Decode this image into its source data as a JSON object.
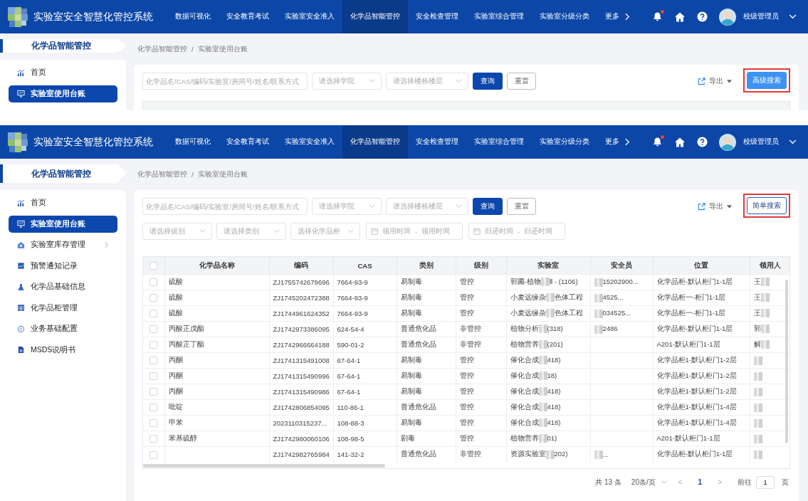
{
  "screens": [
    {
      "kind": "cropped",
      "app_title": "实验室安全智慧化管控系统",
      "nav": [
        {
          "label": "数据可视化",
          "selected": false
        },
        {
          "label": "安全教育考试",
          "selected": false
        },
        {
          "label": "实验室安全准入",
          "selected": false
        },
        {
          "label": "化学品智能管控",
          "selected": true
        },
        {
          "label": "安全检查管理",
          "selected": false
        },
        {
          "label": "实验室综合管理",
          "selected": false
        },
        {
          "label": "实验室分级分类",
          "selected": false
        }
      ],
      "more": {
        "label": "更多"
      },
      "notifications": {
        "unread": true
      },
      "user": {
        "name": "校级管理员"
      },
      "sidebar": {
        "title": "化学品智能管控",
        "items": [
          {
            "label": "首页",
            "selected": false,
            "submenu": false
          },
          {
            "label": "实验室使用台账",
            "selected": true,
            "submenu": false
          }
        ]
      },
      "breadcrumb": {
        "items": [
          "化学品智能管控",
          "实验室使用台账"
        ],
        "separator": "/"
      },
      "filters": [
        [
          {
            "kind": "input",
            "placeholder": "化学品名/CAS/编码/实验室/房间号/姓名/联系方式"
          },
          {
            "kind": "select",
            "placeholder": "请选择学院"
          },
          {
            "kind": "select",
            "placeholder": "请选择楼栋楼层"
          },
          {
            "kind": "primary",
            "label": "查询"
          },
          {
            "kind": "plain",
            "label": "重置"
          }
        ]
      ],
      "export": {
        "label": "导出"
      },
      "toggle": {
        "label": "高级搜索",
        "kind": "filled",
        "highlighted": true
      }
    },
    {
      "kind": "full",
      "app_title": "实验室安全智慧化管控系统",
      "nav": [
        {
          "label": "数据可视化",
          "selected": false
        },
        {
          "label": "安全教育考试",
          "selected": false
        },
        {
          "label": "实验室安全准入",
          "selected": false
        },
        {
          "label": "化学品智能管控",
          "selected": true
        },
        {
          "label": "安全检查管理",
          "selected": false
        },
        {
          "label": "实验室综合管理",
          "selected": false
        },
        {
          "label": "实验室分级分类",
          "selected": false
        }
      ],
      "more": {
        "label": "更多"
      },
      "notifications": {
        "unread": true
      },
      "user": {
        "name": "校级管理员"
      },
      "sidebar": {
        "title": "化学品智能管控",
        "items": [
          {
            "label": "首页",
            "selected": false,
            "submenu": false
          },
          {
            "label": "实验室使用台账",
            "selected": true,
            "submenu": false
          },
          {
            "label": "实验室库存管理",
            "selected": false,
            "submenu": true
          },
          {
            "label": "预警通知记录",
            "selected": false,
            "submenu": false
          },
          {
            "label": "化学品基础信息",
            "selected": false,
            "submenu": false
          },
          {
            "label": "化学品柜管理",
            "selected": false,
            "submenu": false
          },
          {
            "label": "业务基础配置",
            "selected": false,
            "submenu": false
          },
          {
            "label": "MSDS说明书",
            "selected": false,
            "submenu": false
          }
        ]
      },
      "breadcrumb": {
        "items": [
          "化学品智能管控",
          "实验室使用台账"
        ],
        "separator": "/"
      },
      "filters": [
        [
          {
            "kind": "input",
            "placeholder": "化学品名/CAS/编码/实验室/房间号/姓名/联系方式"
          },
          {
            "kind": "select",
            "placeholder": "请选择学院"
          },
          {
            "kind": "select",
            "placeholder": "请选择楼栋楼层"
          },
          {
            "kind": "primary",
            "label": "查询"
          },
          {
            "kind": "plain",
            "label": "重置"
          }
        ],
        [
          {
            "kind": "select",
            "placeholder": "请选择级别"
          },
          {
            "kind": "select",
            "placeholder": "请选择类别"
          },
          {
            "kind": "select",
            "placeholder": "选择化学品柜"
          },
          {
            "kind": "daterange",
            "start": "领用时间",
            "end": "领用时间",
            "separator": "-"
          },
          {
            "kind": "daterange",
            "start": "归还时间",
            "end": "归还时间",
            "separator": "-"
          }
        ]
      ],
      "export": {
        "label": "导出"
      },
      "toggle": {
        "label": "简单搜索",
        "kind": "outline",
        "highlighted": true
      },
      "table": {
        "select_all": {
          "checked": false
        },
        "columns": [
          "化学品名称",
          "编码",
          "CAS",
          "类别",
          "级别",
          "实验室",
          "安全员",
          "位置",
          "领用人"
        ],
        "rows": [
          {
            "checked": false,
            "cells": [
              "硫酸",
              "ZJ1755742679696",
              "7664-93-9",
              "易制毒",
              "管控",
              [
                {
                  "kind": "text",
                  "text": "郭圃-植物"
                },
                {
                  "kind": "blur"
                },
                {
                  "kind": "text",
                  "text": "Ⅱ - (1106)"
                }
              ],
              [
                {
                  "kind": "blur"
                },
                {
                  "kind": "text",
                  "text": "15202900..."
                }
              ],
              "化学品柜-默认柜门1-1层",
              [
                {
                  "kind": "text",
                  "text": "王"
                },
                {
                  "kind": "blur"
                }
              ]
            ]
          },
          {
            "checked": false,
            "cells": [
              "硫酸",
              "ZJ1745202472388",
              "7664-93-9",
              "易制毒",
              "管控",
              [
                {
                  "kind": "text",
                  "text": "小麦远缘杂"
                },
                {
                  "kind": "blur"
                },
                {
                  "kind": "text",
                  "text": "色体工程"
                }
              ],
              [
                {
                  "kind": "blur"
                },
                {
                  "kind": "text",
                  "text": "4525..."
                }
              ],
              "化学品柜一-柜门1-1层",
              [
                {
                  "kind": "text",
                  "text": "王"
                },
                {
                  "kind": "blur"
                }
              ]
            ]
          },
          {
            "checked": false,
            "cells": [
              "硫酸",
              "ZJ1744961624352",
              "7664-93-9",
              "易制毒",
              "管控",
              [
                {
                  "kind": "text",
                  "text": "小麦远缘杂"
                },
                {
                  "kind": "blur"
                },
                {
                  "kind": "text",
                  "text": "色体工程"
                }
              ],
              [
                {
                  "kind": "blur"
                },
                {
                  "kind": "text",
                  "text": "034525..."
                }
              ],
              "化学品柜一-柜门1-1层",
              [
                {
                  "kind": "text",
                  "text": "王"
                },
                {
                  "kind": "blur"
                }
              ]
            ]
          },
          {
            "checked": false,
            "cells": [
              "丙酸正戊酯",
              "ZJ1742973386095",
              "624-54-4",
              "普通危化品",
              "非管控",
              [
                {
                  "kind": "text",
                  "text": "植物分析"
                },
                {
                  "kind": "blur"
                },
                {
                  "kind": "text",
                  "text": "(318)"
                }
              ],
              [
                {
                  "kind": "blur"
                },
                {
                  "kind": "text",
                  "text": "2486"
                }
              ],
              "化学品柜-默认柜门1-1层",
              [
                {
                  "kind": "text",
                  "text": "郭"
                },
                {
                  "kind": "blur"
                }
              ]
            ]
          },
          {
            "checked": false,
            "cells": [
              "丙酸正丁酯",
              "ZJ1742966664188",
              "590-01-2",
              "普通危化品",
              "非管控",
              [
                {
                  "kind": "text",
                  "text": "植物营养"
                },
                {
                  "kind": "blur"
                },
                {
                  "kind": "text",
                  "text": "(201)"
                }
              ],
              null,
              "A201-默认柜门1-1层",
              [
                {
                  "kind": "text",
                  "text": "解"
                },
                {
                  "kind": "blur"
                }
              ]
            ]
          },
          {
            "checked": false,
            "cells": [
              "丙酮",
              "ZJ1741315491008",
              "67-64-1",
              "易制毒",
              "管控",
              [
                {
                  "kind": "text",
                  "text": "催化合成"
                },
                {
                  "kind": "blur"
                },
                {
                  "kind": "text",
                  "text": "418)"
                }
              ],
              null,
              "化学品柜1-默认柜门1-2层",
              [
                {
                  "kind": "blur"
                }
              ]
            ]
          },
          {
            "checked": false,
            "cells": [
              "丙酮",
              "ZJ1741315490996",
              "67-64-1",
              "易制毒",
              "管控",
              [
                {
                  "kind": "text",
                  "text": "催化合成"
                },
                {
                  "kind": "blur"
                },
                {
                  "kind": "text",
                  "text": "18)"
                }
              ],
              null,
              "化学品柜1-默认柜门1-2层",
              [
                {
                  "kind": "blur"
                }
              ]
            ]
          },
          {
            "checked": false,
            "cells": [
              "丙酮",
              "ZJ1741315490986",
              "67-64-1",
              "易制毒",
              "管控",
              [
                {
                  "kind": "text",
                  "text": "催化合成"
                },
                {
                  "kind": "blur"
                },
                {
                  "kind": "text",
                  "text": "418)"
                }
              ],
              null,
              "化学品柜1-默认柜门1-2层",
              [
                {
                  "kind": "blur"
                }
              ]
            ]
          },
          {
            "checked": false,
            "cells": [
              "吡啶",
              "ZJ1742806854095",
              "110-86-1",
              "普通危化品",
              "管控",
              [
                {
                  "kind": "text",
                  "text": "催化合成"
                },
                {
                  "kind": "blur"
                },
                {
                  "kind": "text",
                  "text": "418)"
                }
              ],
              null,
              "化学品柜1-默认柜门1-4层",
              [
                {
                  "kind": "blur"
                }
              ]
            ]
          },
          {
            "checked": false,
            "cells": [
              "甲苯",
              "2023110315237...",
              "108-88-3",
              "易制毒",
              "管控",
              [
                {
                  "kind": "text",
                  "text": "催化合成"
                },
                {
                  "kind": "blur"
                },
                {
                  "kind": "text",
                  "text": "418)"
                }
              ],
              null,
              "化学品柜1-默认柜门1-4层",
              [
                {
                  "kind": "blur"
                }
              ]
            ]
          },
          {
            "checked": false,
            "cells": [
              "苯基硫醇",
              "ZJ1742980060106",
              "108-98-5",
              "剧毒",
              "管控",
              [
                {
                  "kind": "text",
                  "text": "植物营养"
                },
                {
                  "kind": "blur"
                },
                {
                  "kind": "text",
                  "text": "01)"
                }
              ],
              null,
              "A201-默认柜门1-1层",
              [
                {
                  "kind": "blur"
                }
              ]
            ]
          },
          {
            "checked": false,
            "cells": [
              null,
              "ZJ1742982765984",
              "141-32-2",
              "普通危化品",
              "非管控",
              [
                {
                  "kind": "text",
                  "text": "资源实验室"
                },
                {
                  "kind": "blur"
                },
                {
                  "kind": "text",
                  "text": "202)"
                }
              ],
              [
                {
                  "kind": "blur"
                },
                {
                  "kind": "text",
                  "text": "..."
                }
              ],
              "化学品柜-默认柜门1-1层",
              [
                {
                  "kind": "blur"
                }
              ]
            ]
          }
        ]
      },
      "pagination": {
        "total": "共 13 条",
        "page_size": "20条/页",
        "prev": "<",
        "pages": [
          {
            "label": "1",
            "selected": true
          }
        ],
        "next": ">",
        "goto_label": "前往",
        "goto_value": "1",
        "goto_unit": "页"
      }
    }
  ]
}
